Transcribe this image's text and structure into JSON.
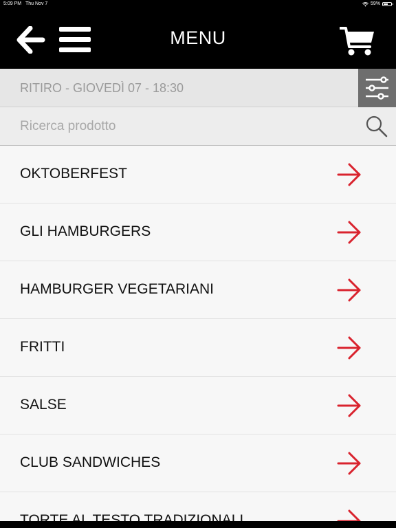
{
  "status_bar": {
    "time": "5:09 PM",
    "date": "Thu Nov 7",
    "battery": "59%",
    "battery_level": 0.59
  },
  "header": {
    "title": "MENU",
    "back_icon": "arrow-left-icon",
    "menu_icon": "hamburger-menu-icon",
    "cart_icon": "shopping-cart-icon"
  },
  "pickup": {
    "text": "RITIRO - GIOVEDÌ 07 - 18:30",
    "filter_icon": "sliders-icon"
  },
  "search": {
    "placeholder": "Ricerca prodotto",
    "value": "",
    "icon": "search-icon"
  },
  "categories": [
    {
      "label": "OKTOBERFEST"
    },
    {
      "label": "GLI HAMBURGERS"
    },
    {
      "label": "HAMBURGER VEGETARIANI"
    },
    {
      "label": "FRITTI"
    },
    {
      "label": "SALSE"
    },
    {
      "label": "CLUB SANDWICHES"
    },
    {
      "label": "TORTE AL TESTO TRADIZIONALI"
    }
  ],
  "colors": {
    "header_bg": "#000000",
    "accent_arrow": "#d9232e",
    "filter_bg": "#6e6e6e"
  }
}
